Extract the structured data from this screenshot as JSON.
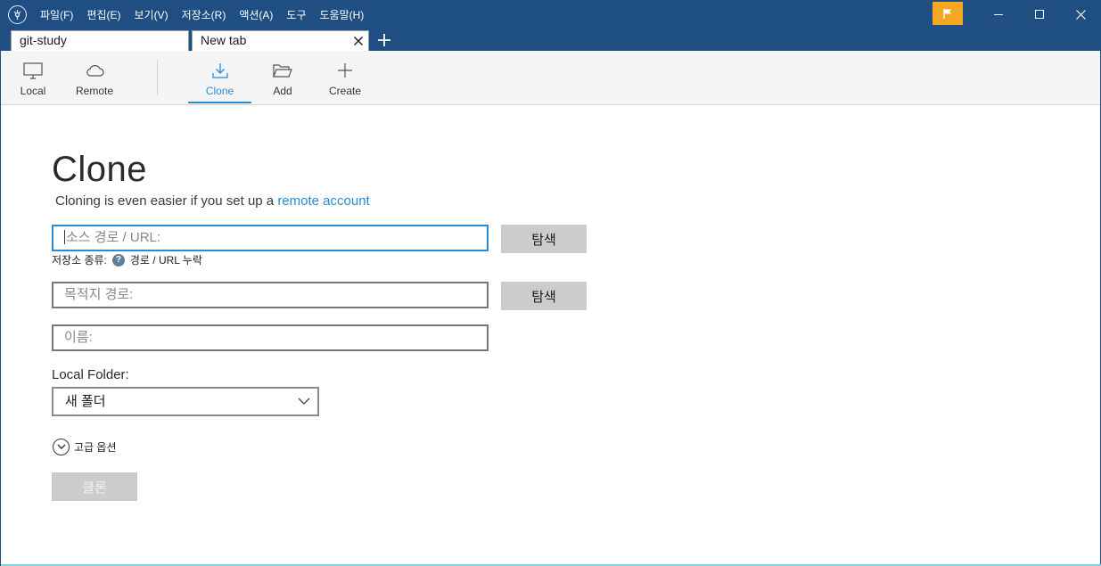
{
  "menu": {
    "items": [
      "파일(F)",
      "편집(E)",
      "보기(V)",
      "저장소(R)",
      "액션(A)",
      "도구",
      "도움말(H)"
    ]
  },
  "tabs": [
    {
      "label": "git-study",
      "active": false
    },
    {
      "label": "New tab",
      "active": true
    }
  ],
  "toolbar": {
    "local_label": "Local",
    "remote_label": "Remote",
    "clone_label": "Clone",
    "add_label": "Add",
    "create_label": "Create",
    "active": "Clone"
  },
  "clone_page": {
    "title": "Clone",
    "subtitle_prefix": "Cloning is even easier if you set up a ",
    "subtitle_link": "remote account",
    "source_placeholder": "소스 경로 / URL:",
    "browse_label": "탐색",
    "repo_type_label": "저장소 종류:",
    "repo_type_value": "경로 / URL 누락",
    "destination_placeholder": "목적지 경로:",
    "browse_label_2": "탐색",
    "name_placeholder": "이름:",
    "local_folder_label": "Local Folder:",
    "local_folder_value": "새 폴더",
    "advanced_label": "고급 옵션",
    "clone_button_label": "클론"
  },
  "colors": {
    "titlebar": "#1f4e83",
    "accent": "#2a8ad4",
    "flag": "#f5a623",
    "button_gray": "#cccccc"
  },
  "icons": {
    "app": "sourcetree-logo-icon",
    "flag": "flag-icon",
    "local": "monitor-icon",
    "remote": "cloud-icon",
    "clone": "download-icon",
    "add": "folder-open-icon",
    "create": "plus-icon",
    "help": "question-icon",
    "advanced": "chevron-down-circle-icon"
  }
}
